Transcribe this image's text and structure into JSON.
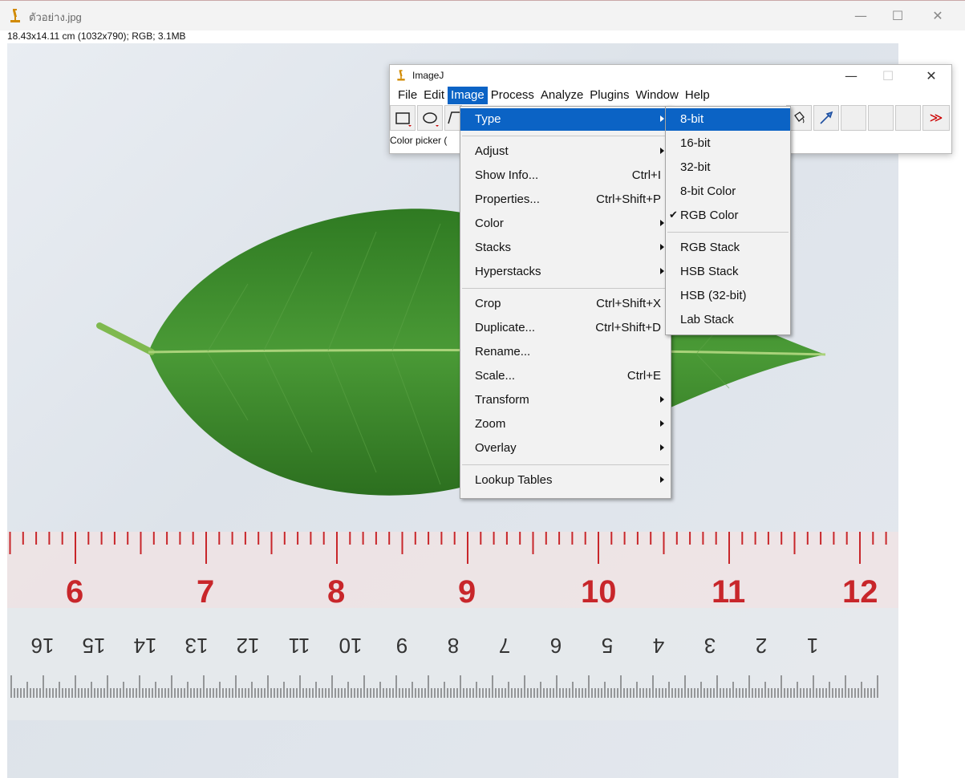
{
  "window": {
    "title": "ตัวอย่าง.jpg",
    "info": "18.43x14.11 cm (1032x790); RGB; 3.1MB"
  },
  "imagej": {
    "title": "ImageJ",
    "menus": [
      "File",
      "Edit",
      "Image",
      "Process",
      "Analyze",
      "Plugins",
      "Window",
      "Help"
    ],
    "status": "Color picker (",
    "image_menu": [
      {
        "label": "Type",
        "shortcut": "",
        "submenu": true
      },
      {
        "label": "Adjust",
        "shortcut": "",
        "submenu": true
      },
      {
        "label": "Show Info...",
        "shortcut": "Ctrl+I",
        "submenu": false
      },
      {
        "label": "Properties...",
        "shortcut": "Ctrl+Shift+P",
        "submenu": false
      },
      {
        "label": "Color",
        "shortcut": "",
        "submenu": true
      },
      {
        "label": "Stacks",
        "shortcut": "",
        "submenu": true
      },
      {
        "label": "Hyperstacks",
        "shortcut": "",
        "submenu": true
      },
      {
        "label": "Crop",
        "shortcut": "Ctrl+Shift+X",
        "submenu": false
      },
      {
        "label": "Duplicate...",
        "shortcut": "Ctrl+Shift+D",
        "submenu": false
      },
      {
        "label": "Rename...",
        "shortcut": "",
        "submenu": false
      },
      {
        "label": "Scale...",
        "shortcut": "Ctrl+E",
        "submenu": false
      },
      {
        "label": "Transform",
        "shortcut": "",
        "submenu": true
      },
      {
        "label": "Zoom",
        "shortcut": "",
        "submenu": true
      },
      {
        "label": "Overlay",
        "shortcut": "",
        "submenu": true
      },
      {
        "label": "Lookup Tables",
        "shortcut": "",
        "submenu": true
      }
    ],
    "type_menu": [
      {
        "label": "8-bit",
        "checked": false
      },
      {
        "label": "16-bit",
        "checked": false
      },
      {
        "label": "32-bit",
        "checked": false
      },
      {
        "label": "8-bit Color",
        "checked": false
      },
      {
        "label": "RGB Color",
        "checked": true
      },
      {
        "label": "RGB Stack",
        "checked": false
      },
      {
        "label": "HSB Stack",
        "checked": false
      },
      {
        "label": "HSB (32-bit)",
        "checked": false
      },
      {
        "label": "Lab Stack",
        "checked": false
      }
    ],
    "checkmark": "✔"
  },
  "ruler": {
    "cm_labels": [
      "6",
      "7",
      "8",
      "9",
      "10",
      "11",
      "12"
    ],
    "inch_labels": [
      "16",
      "15",
      "14",
      "13",
      "12",
      "11",
      "10",
      "9",
      "8",
      "7",
      "6",
      "5",
      "4",
      "3",
      "2",
      "1"
    ]
  },
  "icons": {
    "app": "imagej-microscope-icon",
    "close": "✕",
    "min": "—",
    "max": "☐",
    "more": "≫"
  },
  "colors": {
    "menu_highlight": "#0b63c5",
    "ruler_text": "#c8262a",
    "leaf": "#3f8a2f"
  }
}
